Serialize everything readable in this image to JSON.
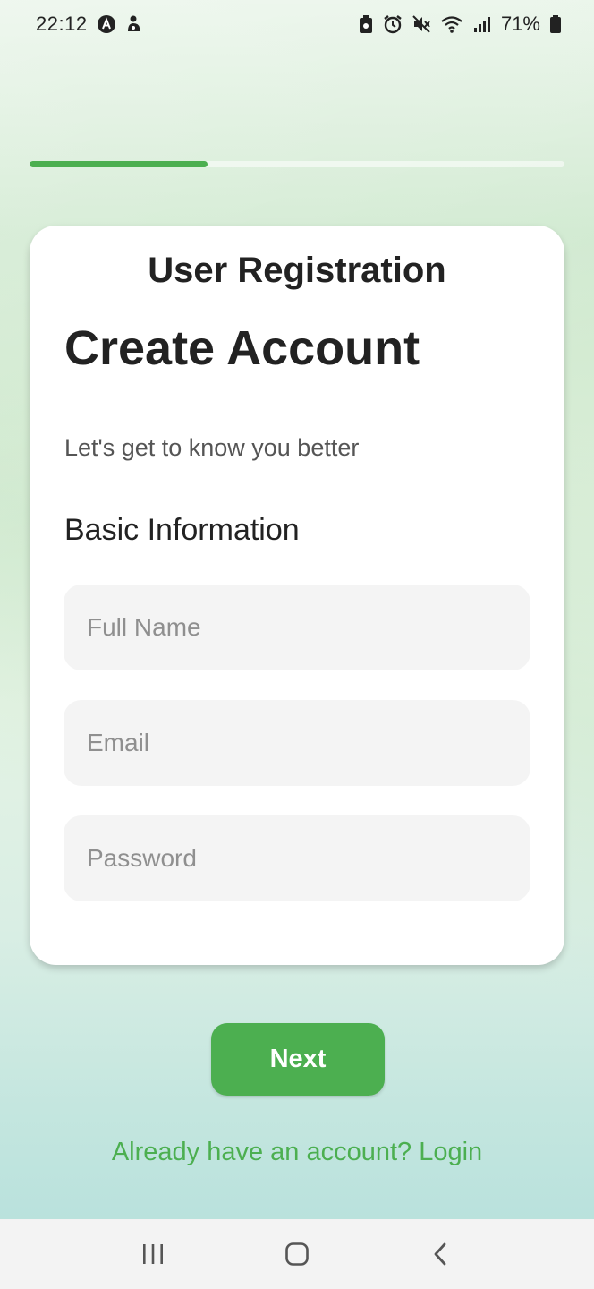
{
  "status_bar": {
    "time": "22:12",
    "battery_percent": "71%",
    "left_icons": [
      "app-a-icon",
      "notification-figure-icon"
    ],
    "right_icons": [
      "battery-saver-icon",
      "alarm-icon",
      "mute-icon",
      "wifi-icon",
      "signal-icon",
      "battery-icon"
    ]
  },
  "progress": {
    "fraction": 0.333,
    "track_color": "#ffffff",
    "fill_color": "#4caf50"
  },
  "card": {
    "header": "User Registration",
    "title": "Create Account",
    "subtitle": "Let's get to know you better",
    "section_title": "Basic Information",
    "fields": {
      "full_name_placeholder": "Full Name",
      "email_placeholder": "Email",
      "password_placeholder": "Password"
    }
  },
  "actions": {
    "next_label": "Next",
    "login_link": "Already have an account? Login"
  },
  "nav_bar": {
    "buttons": [
      "recent-apps-icon",
      "home-icon",
      "back-icon"
    ]
  },
  "colors": {
    "accent": "#4caf50",
    "card_background": "#ffffff",
    "field_background": "#f4f4f4"
  }
}
